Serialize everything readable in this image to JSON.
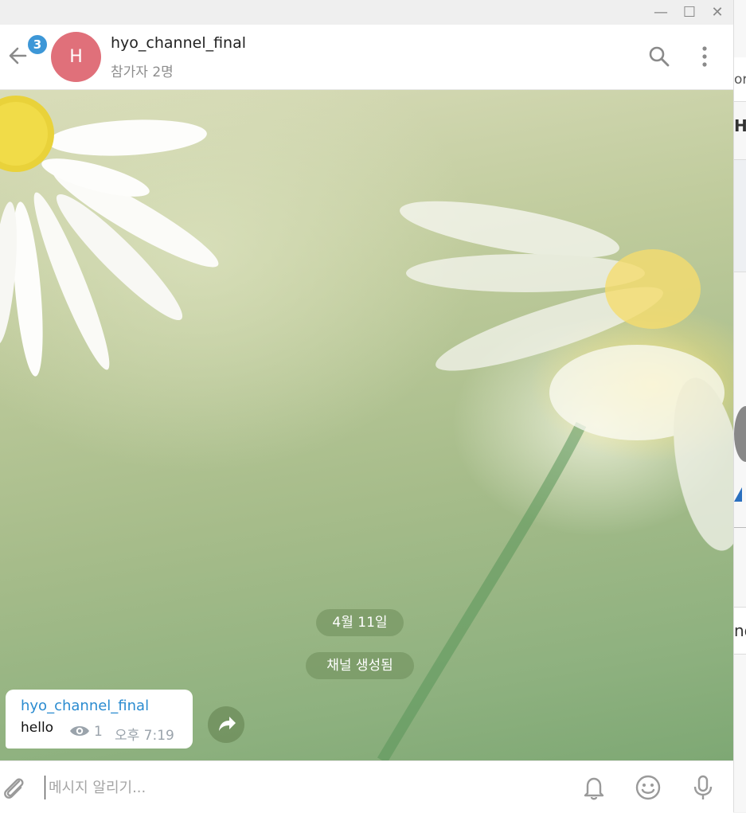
{
  "window": {
    "minimize_glyph": "—",
    "maximize_glyph": "☐",
    "close_glyph": "✕"
  },
  "header": {
    "unread_badge": "3",
    "avatar_letter": "H",
    "title": "hyo_channel_final",
    "subtitle": "참가자 2명",
    "avatar_color": "#e0707a",
    "badge_color": "#3d97d7"
  },
  "chat": {
    "date_separator": "4월 11일",
    "service_message": "채널 생성됨",
    "messages": [
      {
        "author": "hyo_channel_final",
        "text": "hello",
        "views": "1",
        "time": "오후 7:19"
      }
    ]
  },
  "composer": {
    "placeholder": "메시지 알리기..."
  },
  "background_window": {
    "fragments": [
      "or",
      "Hi",
      "nd"
    ]
  },
  "icons": [
    "back-arrow-icon",
    "search-icon",
    "more-vertical-icon",
    "eye-icon",
    "share-icon",
    "paperclip-icon",
    "bell-icon",
    "emoji-icon",
    "microphone-icon"
  ]
}
